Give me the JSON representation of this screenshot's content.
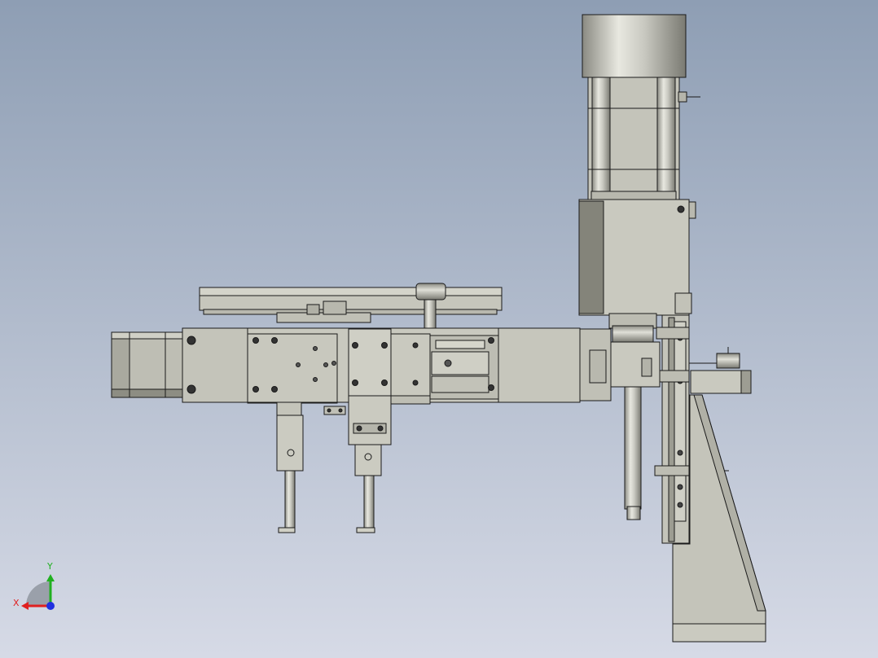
{
  "viewport": {
    "background_top": "#8e9eb4",
    "background_bottom": "#d6dae6"
  },
  "colors": {
    "part_fill": "#c9c9bf",
    "part_fill_light": "#d8d8cf",
    "part_fill_dark": "#8f8f85",
    "part_shadow": "#76766c",
    "edge": "#1a1a1a",
    "motor_body": "#bdbdb3",
    "motor_cap": "#a5a59b",
    "axis_x": "#e02020",
    "axis_y": "#20b020",
    "axis_z": "#2030e0",
    "triad_shade": "#9aa0aa"
  },
  "triad": {
    "x_label": "X",
    "y_label": "Y"
  }
}
